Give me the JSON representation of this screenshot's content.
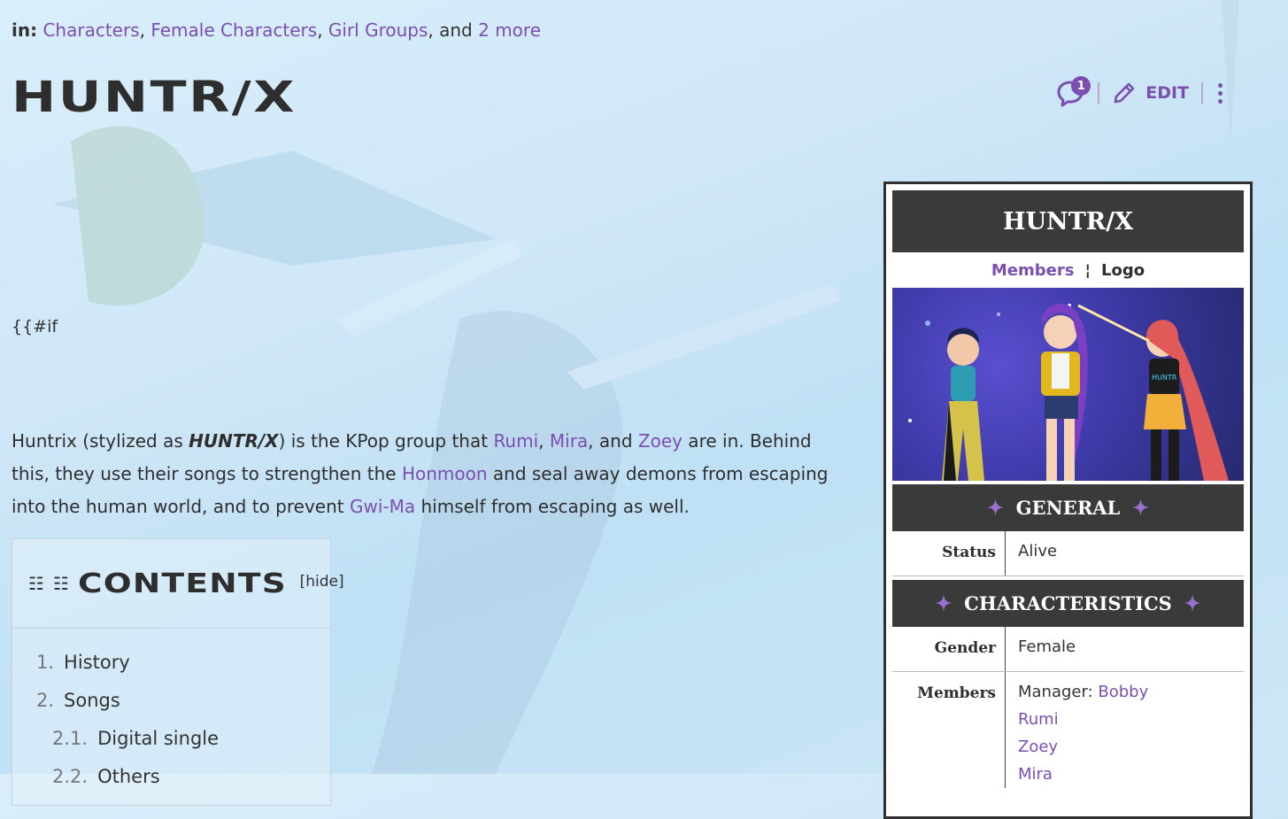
{
  "categories": {
    "prefix": "in:",
    "links": [
      "Characters",
      "Female Characters",
      "Girl Groups"
    ],
    "conj": ", and",
    "more": "2 more"
  },
  "page": {
    "title": "HUNTR/X",
    "if_stub": "{{#if"
  },
  "actions": {
    "comment_count": "1",
    "edit_label": "EDIT"
  },
  "intro": {
    "t1": "Huntrix (stylized as ",
    "styled": "HUNTR/X",
    "t2": ") is the KPop group that ",
    "rumi": "Rumi",
    "t3": ", ",
    "mira": "Mira",
    "t4": ", and ",
    "zoey": "Zoey",
    "t5": " are in. Behind this, they use their songs to strengthen the ",
    "honmoon": "Honmoon",
    "t6": " and seal away demons from escaping into the human world, and to prevent ",
    "gwima": "Gwi-Ma",
    "t7": " himself from escaping as well."
  },
  "toc": {
    "title": "CONTENTS",
    "hide": "[hide]",
    "items": [
      {
        "num": "1.",
        "text": "History"
      },
      {
        "num": "2.",
        "text": "Songs"
      },
      {
        "num": "2.1.",
        "text": "Digital single"
      },
      {
        "num": "2.2.",
        "text": "Others"
      }
    ]
  },
  "infobox": {
    "title": "HUNTR/X",
    "tab_members": "Members",
    "tab_sep": "¦",
    "tab_logo": "Logo",
    "section_general": "GENERAL",
    "section_characteristics": "CHARACTERISTICS",
    "star": "✦",
    "status_label": "Status",
    "status_value": "Alive",
    "gender_label": "Gender",
    "gender_value": "Female",
    "members_label": "Members",
    "manager_prefix": "Manager: ",
    "manager_name": "Bobby",
    "members": [
      "Rumi",
      "Zoey",
      "Mira"
    ]
  },
  "colors": {
    "accent": "#7a4fb0",
    "dark_header": "#3a3a3a",
    "background": "#cfe7f7"
  }
}
